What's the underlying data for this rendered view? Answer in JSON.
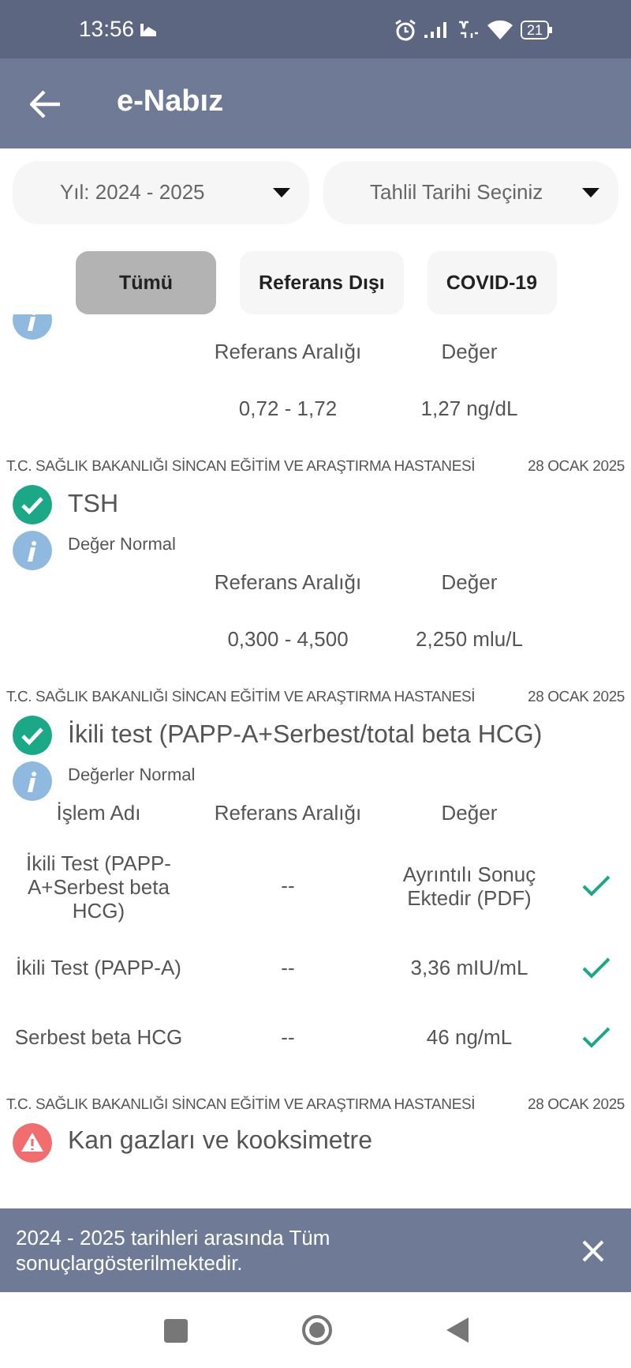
{
  "status_bar": {
    "time": "13:56",
    "battery": "21"
  },
  "app_bar": {
    "title": "e-Nabız"
  },
  "filters": [
    {
      "label": "Yıl: 2024 - 2025"
    },
    {
      "label": "Tahlil Tarihi Seçiniz"
    }
  ],
  "chips": [
    {
      "label": "Tümü",
      "selected": true
    },
    {
      "label": "Referans Dışı",
      "selected": false
    },
    {
      "label": "COVID-19",
      "selected": false
    }
  ],
  "results": [
    {
      "info": true,
      "columns": [
        "Referans Aralığı",
        "Değer"
      ],
      "rows": [
        {
          "reference": "0,72 - 1,72",
          "value": "1,27 ng/dL"
        }
      ]
    },
    {
      "hospital": "T.C. SAĞLIK BAKANLIĞI SİNCAN EĞİTİM VE ARAŞTIRMA HASTANESİ",
      "date": "28 OCAK 2025",
      "kind": "ok",
      "name": "TSH",
      "note": "Değer Normal",
      "columns": [
        "Referans Aralığı",
        "Değer"
      ],
      "rows": [
        {
          "reference": "0,300 - 4,500",
          "value": "2,250 mlu/L"
        }
      ]
    },
    {
      "hospital": "T.C. SAĞLIK BAKANLIĞI SİNCAN EĞİTİM VE ARAŞTIRMA HASTANESİ",
      "date": "28 OCAK 2025",
      "kind": "ok",
      "name": "İkili test (PAPP-A+Serbest/total beta HCG)",
      "note": "Değerler Normal",
      "columns": [
        "İşlem Adı",
        "Referans Aralığı",
        "Değer"
      ],
      "rows": [
        {
          "name": "İkili Test (PAPP-A+Serbest beta HCG)",
          "reference": "--",
          "value": "Ayrıntılı Sonuç Ektedir (PDF)",
          "checked": true
        },
        {
          "name": "İkili Test (PAPP-A)",
          "reference": "--",
          "value": "3,36 mIU/mL",
          "checked": true
        },
        {
          "name": "Serbest beta HCG",
          "reference": "--",
          "value": "46 ng/mL",
          "checked": true
        }
      ]
    },
    {
      "hospital": "T.C. SAĞLIK BAKANLIĞI SİNCAN EĞİTİM VE ARAŞTIRMA HASTANESİ",
      "date": "28 OCAK 2025",
      "kind": "alert",
      "name": "Kan gazları ve kooksimetre"
    }
  ],
  "snackbar": {
    "message": "2024 - 2025 tarihleri arasında Tüm sonuçlargösterilmektedir."
  }
}
